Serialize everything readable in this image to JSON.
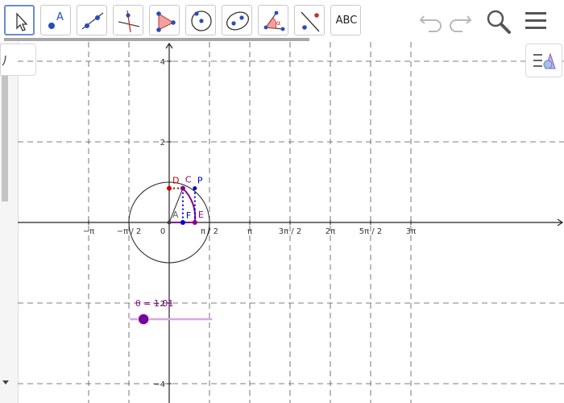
{
  "toolbar": {
    "tools": [
      {
        "name": "move-tool",
        "active": true
      },
      {
        "name": "point-tool",
        "label": "A"
      },
      {
        "name": "line-tool"
      },
      {
        "name": "perpendicular-line-tool"
      },
      {
        "name": "polygon-tool"
      },
      {
        "name": "circle-center-point-tool"
      },
      {
        "name": "ellipse-tool"
      },
      {
        "name": "angle-tool",
        "label": "α"
      },
      {
        "name": "reflect-tool"
      },
      {
        "name": "text-tool",
        "label": "ABC"
      }
    ],
    "icons": [
      "undo-icon",
      "redo-icon",
      "search-icon",
      "menu-icon"
    ]
  },
  "graphics": {
    "x_ticks": [
      "−π",
      "−π / 2",
      "0",
      "π / 2",
      "π",
      "3π / 2",
      "2π",
      "5π / 2",
      "3π"
    ],
    "y_ticks": [
      "4",
      "2",
      "−2",
      "−4"
    ],
    "points": {
      "A": "A",
      "C": "C",
      "D": "D",
      "E": "E",
      "F": "F",
      "P": "P"
    },
    "slider_label": "θ = 1.01",
    "slider_value": 1.01,
    "colors": {
      "purple": "#8b008b",
      "blue": "#0000cc",
      "red": "#cc0000",
      "slider_line": "#d8a8e0"
    }
  }
}
